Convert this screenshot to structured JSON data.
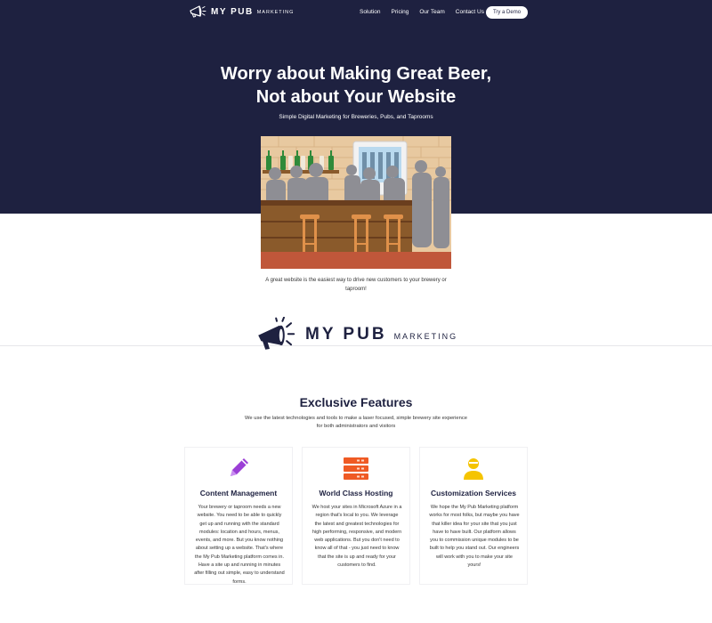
{
  "nav": {
    "brand": "MY PUB",
    "brand_sub": "MARKETING",
    "links": [
      "Solution",
      "Pricing",
      "Our Team",
      "Contact Us"
    ],
    "cta": "Try a Demo"
  },
  "hero": {
    "headline_line1": "Worry about Making Great Beer,",
    "headline_line2": "Not about Your Website",
    "subheadline": "Simple Digital Marketing for Breweries, Pubs, and Taprooms",
    "caption": "A great website is the easiest way to drive new customers to your brewery or taproom!"
  },
  "logo": {
    "brand": "MY PUB",
    "brand_sub": "MARKETING"
  },
  "features": {
    "title": "Exclusive Features",
    "subtitle": "We use the latest technologies and tools to make a laser focused, simple brewery site experience for both administrators and visitors",
    "cards": [
      {
        "icon": "pencil-icon",
        "title": "Content Management",
        "body": "Your brewery or taproom needs a new website. You need to be able to quickly get up and running with the standard modules: location and hours, menus, events, and more. But you know nothing about setting up a website. That's where the My Pub Marketing platform comes in. Have a site up and running in minutes after filling out simple, easy to understand forms."
      },
      {
        "icon": "server-icon",
        "title": "World Class Hosting",
        "body": "We host your sites in Microsoft Azure in a region that's local to you. We leverage the latest and greatest technologies for high performing, responsive, and modern web applications. But you don't need to know all of that - you just need to know that the site is up and ready for your customers to find."
      },
      {
        "icon": "user-icon",
        "title": "Customization Services",
        "body": "We hope the My Pub Marketing platform works for most folks, but maybe you have that killer idea for your site that you just have to have built. Our platform allows you to commission unique modules to be built to help you stand out. Our engineers will work with you to make your site yours!"
      }
    ]
  },
  "colors": {
    "navy": "#1e2140",
    "accent_purple": "#9b3fd6",
    "accent_orange": "#ef5a24",
    "accent_yellow": "#f5c400"
  }
}
